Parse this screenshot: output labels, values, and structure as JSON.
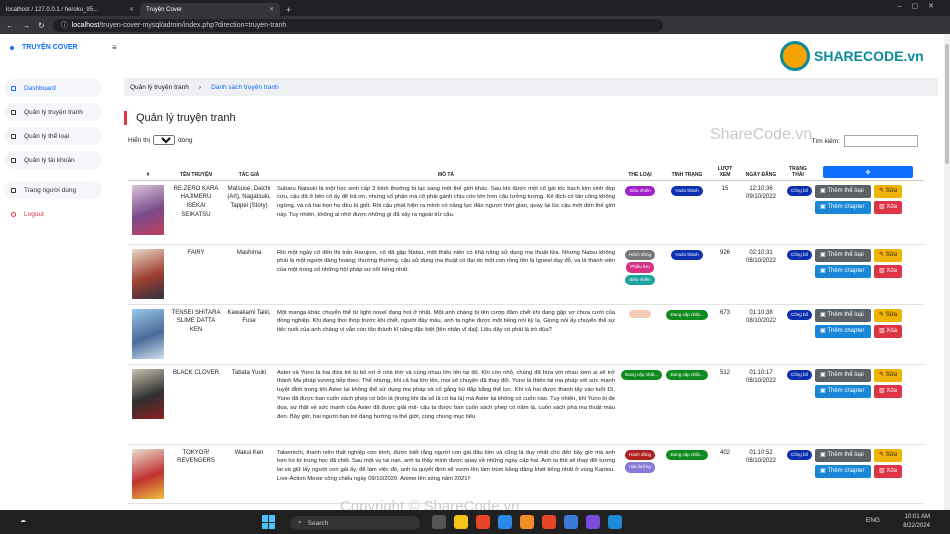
{
  "browser": {
    "tabs": [
      {
        "title": "localhost / 127.0.0.1 / heroku_95...",
        "active": false
      },
      {
        "title": "Truyện Cover",
        "active": true
      }
    ],
    "url_host": "localhost",
    "url_path": "/truyen-cover-mysql/admin/index.php?direction=truyen-tranh"
  },
  "sidebar": {
    "brand": "TRUYỆN COVER",
    "items": [
      {
        "label": "Dashboard",
        "icon": "grid-icon",
        "active": true
      },
      {
        "label": "Quản lý truyện tranh",
        "icon": "book-icon"
      },
      {
        "label": "Quản lý thể loại",
        "icon": "list-icon"
      },
      {
        "label": "Quản lý tài khoản",
        "icon": "user-icon"
      },
      {
        "label": "Trang người dùng",
        "icon": "monitor-icon"
      },
      {
        "label": "Logout",
        "icon": "power-icon"
      }
    ]
  },
  "breadcrumb": {
    "root": "Quản lý truyện tranh",
    "current": "Danh sách truyện tranh"
  },
  "page_title": "Quản lý truyện tranh",
  "table_controls": {
    "show_prefix": "Hiển thị",
    "show_value": "10",
    "show_suffix": "dòng",
    "search_label": "Tìm kiếm:"
  },
  "columns": [
    "#",
    "TÊN TRUYỆN",
    "TÁC GIẢ",
    "MÔ TẢ",
    "THỂ LOẠI",
    "TÌNH TRẠNG",
    "LƯỢT XEM",
    "NGÀY ĐĂNG",
    "TRẠNG THÁI",
    "+"
  ],
  "actions": {
    "add_genre": "Thêm thể loại",
    "edit": "Sửa",
    "add_chapter": "Thêm chapter",
    "delete": "Xóa"
  },
  "rows": [
    {
      "name": "RE:ZERO KARA HAJIMERU ISEKAI SEIKATSU",
      "author": "Matsuse, Daichi (Art), Nagatsuki, Tappei (Story)",
      "desc": "Subaru Natsuki là một học sinh cấp 3 bình thường bị lạc sang một thế giới khác. Sau khi được một cô gái tóc bạch kim xinh đẹp cứu, cậu đã ở bên cô ấy để trả ơn, nhưng số phận mà cô phải gánh chịu còn lớn hơn cậu tưởng tượng. Kẻ địch có tấn công không ngừng, và cả hai bọn họ đều bị giết. Rồi cậu phát hiện ra mình có năng lực đảo ngược thời gian, quay lại lúc cậu mới đến thế giới này. Tuy nhiên, không ai nhớ được những gì đã xảy ra ngoài trừ cậu.",
      "genres": [
        {
          "label": "Siêu nhiên",
          "color": "#a020c8"
        }
      ],
      "status": {
        "label": "Hoàn thành",
        "color": "#0d2fb0"
      },
      "views": "15",
      "time": "12:10:36",
      "date": "09/10/2022",
      "state": "Công bố",
      "cover": [
        "#d8c4d8",
        "#7a4a8a",
        "#c04060"
      ]
    },
    {
      "name": "FAIRY",
      "author": "Mashima",
      "desc": "Rồi một ngày cô đến thị trấn Harujion, cô đã gặp Natsu, một thiếu niên có khả năng sử dụng ma thuật lửa. Nhưng Natsu không phải là một người đàng hoàng; thường thường, cậu sử dụng ma thuật có đại do một con rồng tên là Igneel dạy đỗ, và là thành viên của một trong số những hội pháp sư nổi tiếng nhất.",
      "genres": [
        {
          "label": "Hành động",
          "color": "#777777"
        },
        {
          "label": "Phiêu lưu",
          "color": "#d63384"
        },
        {
          "label": "Siêu nhiên",
          "color": "#1fa2a2"
        }
      ],
      "status": {
        "label": "Hoàn thành",
        "color": "#0d2fb0"
      },
      "views": "926",
      "time": "02:10:31",
      "date": "08/10/2022",
      "state": "Công bố",
      "cover": [
        "#e8d8c8",
        "#a04030",
        "#303040"
      ]
    },
    {
      "name": "TENSEI SHITARA SLIME DATTA KEN",
      "author": "Kawakami Taiki, Fuse",
      "desc": "Một manga khác chuyển thể từ light novel đang hot ở nhật. Một anh chàng bị tên cướp đâm chết khi đang gặp vợ chưa cưới của đồng nghiệp. Khi đang thoi thóp trước khi chết, người đầy máu, anh ta nghe được một tiếng nói kỳ lạ. Giọng nói ấy chuyển thể sự tiếc nuối của anh chàng vì vẫn còn tân thành kĩ năng đặc biệt [tên nhân vĩ đại]. Liệu đây có phải là trò đùa?",
      "genres": [
        {
          "label": "",
          "color": "#f6c9b8"
        }
      ],
      "status": {
        "label": "Đang cập nhật...",
        "color": "#0f8a1e"
      },
      "views": "673",
      "time": "01:10:38",
      "date": "08/10/2022",
      "state": "Công bố",
      "cover": [
        "#9ac8e8",
        "#4a6a9a",
        "#d0e0f0"
      ]
    },
    {
      "name": "BLACK CLOVER",
      "author": "Tabata Yuuki",
      "desc": "Aster và Yuno là hai đứa trẻ bị bỏ rơi ở nhà thờ và cùng nhau lớn lên tại đó. Khi còn nhỏ, chúng đã hứa với nhau xem ai sẽ trở thành Ma pháp vương tiếp theo. Thế nhưng, khi cả hai lớn lên, mọi sô chuyện đã thay đổi. Yuno là thiên tài ma pháp với sức mạnh tuyệt đỉnh trong khi Aster lại không thể sử dụng ma pháp và cố gắng bù đắp bằng thể lực. Khi cả hai được thanh tẩy vào tuổi 15, Yuno đã được ban cuốn sách phép có bốn lá (trong khi đa số là có ba lá) mà Aster lại không có cuốn nào. Tuy nhiên, khi Yuno bị đe dọa, sự thật về sức mạnh của Aster đã được giải mã- cậu ta được ban cuốn sách phép có năm lá, cuốn sách phá ma thuật màu đen. Bây giờ, hai người bạn trẻ đang hướng ra thế giới, cùng chung mục tiêu",
      "genres": [
        {
          "label": "Đang cập nhật...",
          "color": "#0f8a1e"
        }
      ],
      "status": {
        "label": "Đang cập nhật...",
        "color": "#0f8a1e"
      },
      "views": "512",
      "time": "01:10:17",
      "date": "08/10/2022",
      "state": "Công bố",
      "cover": [
        "#c8c0b0",
        "#303030",
        "#8a2020"
      ]
    },
    {
      "name": "TOKYO卍 REVENGERS",
      "author": "Wakui Ken",
      "desc": "Takemichi, thanh niên thất nghiệp còn trinh, được biết rằng người con gái đầu tiên và cũng là duy nhất cho đến bây giờ mà anh hẹn hò từ trung học đã chết. Sau một vụ tai nạn, anh ta thấy mình được quay về những ngày cấp hai. Anh ta thề sẽ thay đổi tương lai và giữ lấy người con gái ấy, để làm việc đó, anh ta quyết định sẽ vươn lên làm trùm băng đảng khét tiếng nhất ở vùng Kantou. Live-Action Movie công chiếu ngày 09/10/2020. Anime lên sóng năm 2021!!",
      "genres": [
        {
          "label": "Hành động",
          "color": "#b02020"
        },
        {
          "label": "Hài dướng",
          "color": "#8a7ad8"
        }
      ],
      "status": {
        "label": "Đang cập nhật...",
        "color": "#0f8a1e"
      },
      "views": "402",
      "time": "01:10:52",
      "date": "08/10/2022",
      "state": "Công bố",
      "cover": [
        "#e8e0d0",
        "#c03030",
        "#f0c040"
      ]
    }
  ],
  "watermarks": {
    "logo": "SHARECODE.vn",
    "center": "ShareCode.vn",
    "bottom": "Copyright © ShareCode.vn"
  },
  "taskbar": {
    "search": "Search",
    "time": "10:01 AM",
    "date": "8/22/2024",
    "lang": "ENG"
  }
}
